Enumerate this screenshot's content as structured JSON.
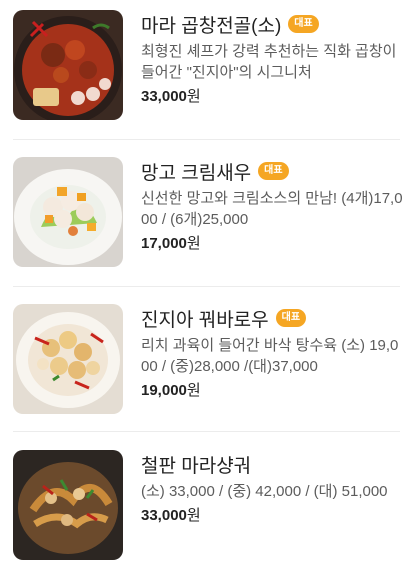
{
  "menu": {
    "items": [
      {
        "name": "마라 곱창전골(소)",
        "badge": "대표",
        "desc": "최형진 셰프가 강력 추천하는 직화 곱창이 들어간 \"진지아\"의 시그니처",
        "price": "33,000",
        "currency": "원",
        "image_icon": "mala-gopchang-hotpot-photo"
      },
      {
        "name": "망고 크림새우",
        "badge": "대표",
        "desc": "신선한 망고와 크림소스의 만남! (4개)17,000 / (6개)25,000",
        "price": "17,000",
        "currency": "원",
        "image_icon": "mango-cream-shrimp-photo"
      },
      {
        "name": "진지아 꿔바로우",
        "badge": "대표",
        "desc": "리치 과육이 들어간 바삭 탕수육 (소) 19,000 / (중)28,000 /(대)37,000",
        "price": "19,000",
        "currency": "원",
        "image_icon": "guobaorou-photo"
      },
      {
        "name": "철판 마라샹궈",
        "badge": "",
        "desc": "(소) 33,000 / (중) 42,000 / (대) 51,000",
        "price": "33,000",
        "currency": "원",
        "image_icon": "mala-xiangguo-photo"
      }
    ]
  }
}
